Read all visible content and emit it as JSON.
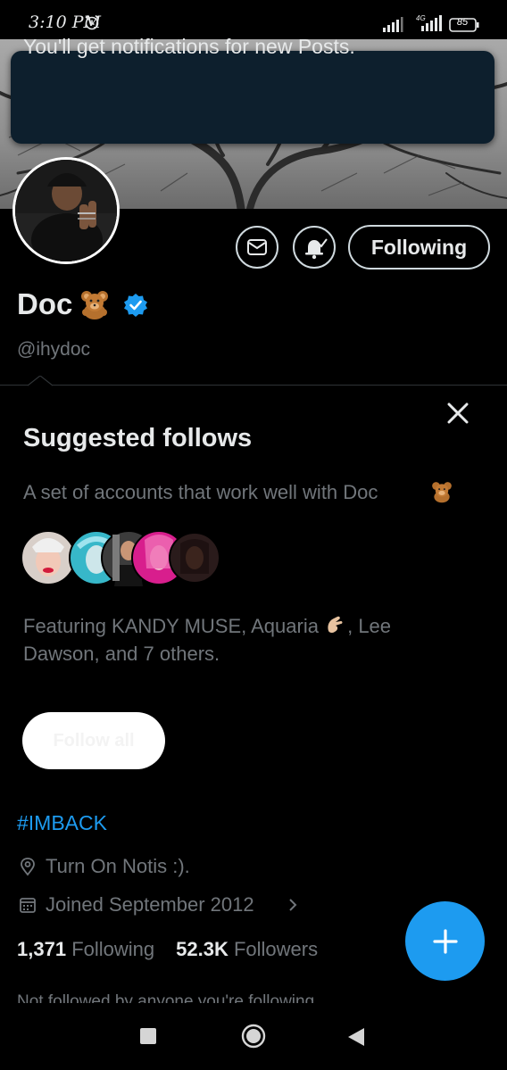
{
  "status_bar": {
    "time": "3:10 PM",
    "network_label": "4G",
    "battery": "85"
  },
  "toast": {
    "text": "You'll get notifications for new Posts."
  },
  "profile": {
    "display_name": "Doc",
    "handle": "@ihydoc",
    "following_label": "Following",
    "bio_hashtag": "#IMBACK",
    "location": "Turn On Notis :).",
    "joined": "Joined September 2012",
    "following_count": "1,371",
    "following_text": "Following",
    "followers_count": "52.3K",
    "followers_text": "Followers",
    "not_followed_text": "Not followed by anyone you're following"
  },
  "suggested": {
    "title": "Suggested follows",
    "subtitle": "A set of accounts that work well with Doc",
    "featuring_prefix": "Featuring KANDY MUSE, Aquaria",
    "featuring_suffix": ", Lee Dawson, and 7 others.",
    "follow_all_label": "Follow all"
  },
  "icons": {
    "alarm": "alarm-icon",
    "message": "envelope-icon",
    "notifications": "bell-check-icon",
    "verified": "verified-badge-icon",
    "close": "close-icon",
    "location": "location-pin-icon",
    "calendar": "calendar-icon",
    "compose": "plus-icon"
  },
  "colors": {
    "accent": "#1d9bf0",
    "background": "#000000",
    "toast_background": "#0d1f2d",
    "secondary_text": "#71767b"
  }
}
